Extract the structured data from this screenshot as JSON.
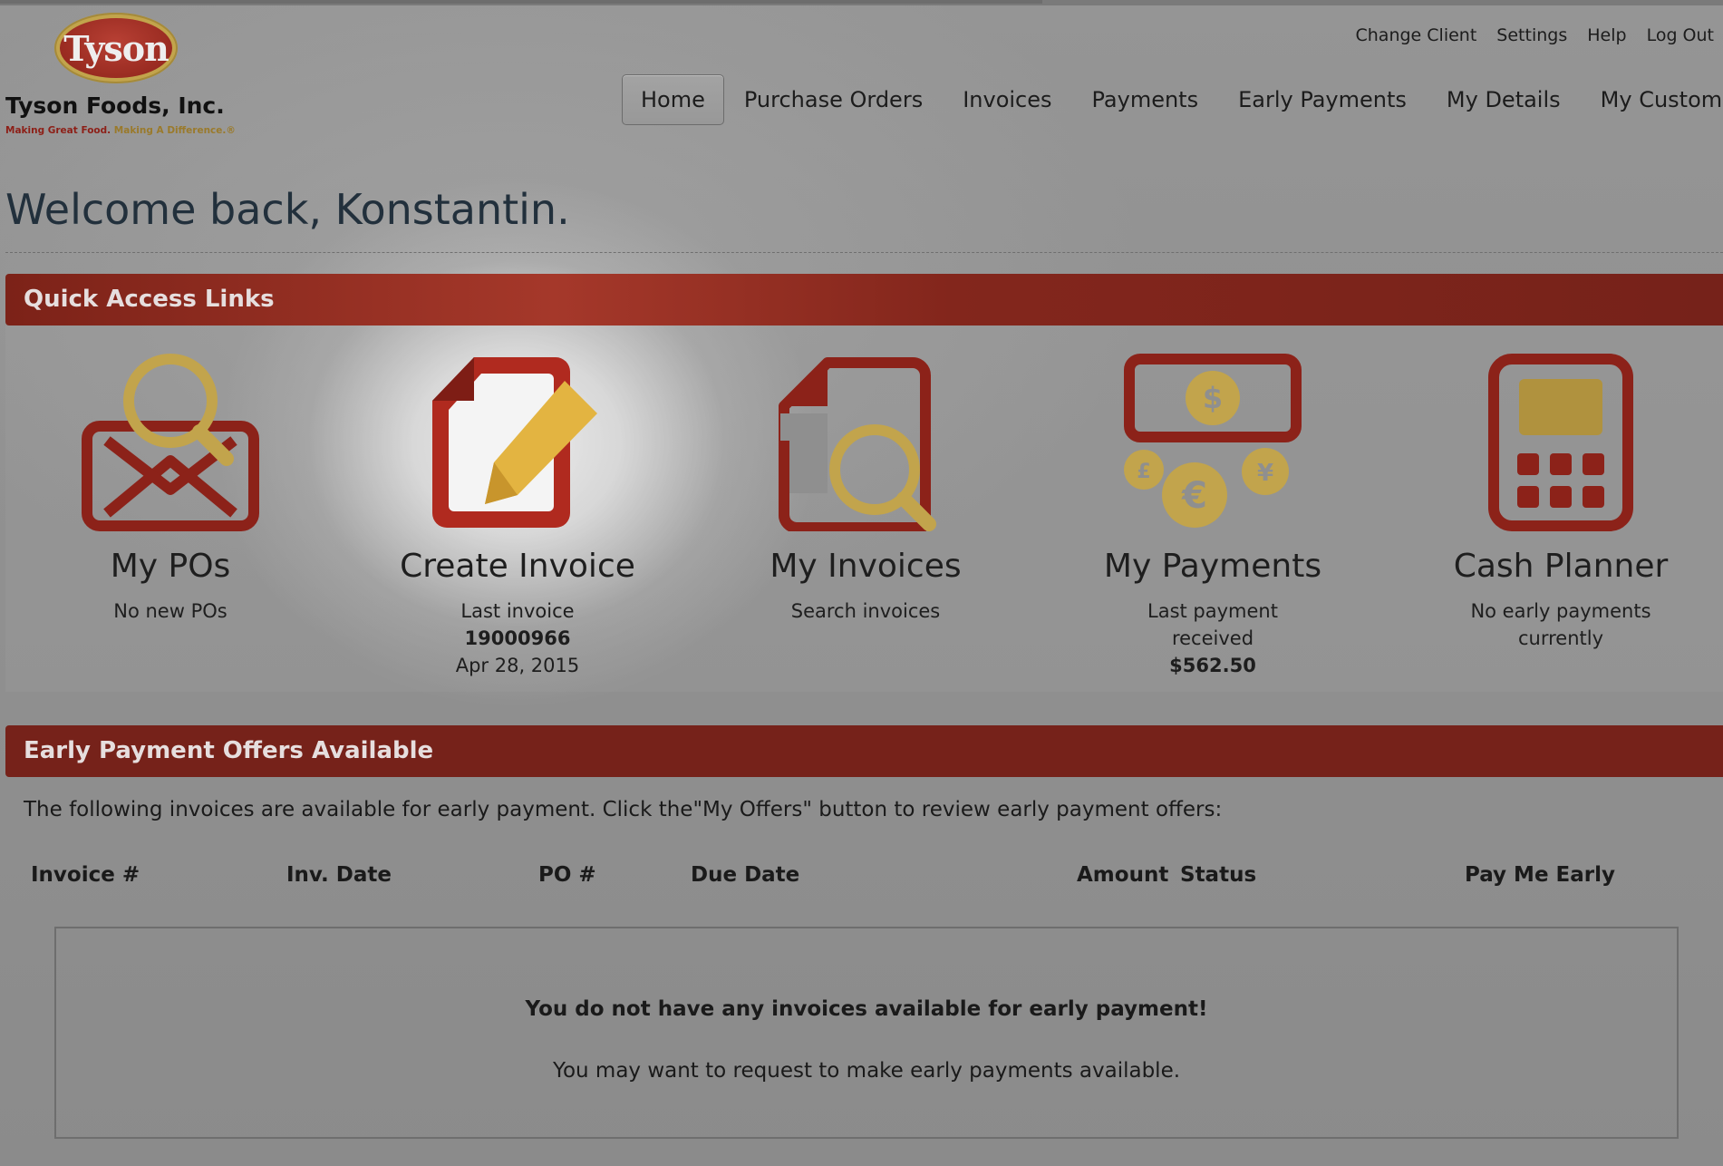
{
  "brand": {
    "logo_word": "Tyson",
    "company": "Tyson Foods, Inc.",
    "tagline_part1": "Making Great Food.",
    "tagline_part2": "Making A Difference.®",
    "colors": {
      "red": "#8c2219",
      "gold": "#c2a44c"
    }
  },
  "util_nav": [
    "Change Client",
    "Settings",
    "Help",
    "Log Out"
  ],
  "main_nav": {
    "active": "Home",
    "items": [
      "Home",
      "Purchase Orders",
      "Invoices",
      "Payments",
      "Early Payments",
      "My Details",
      "My Customer"
    ]
  },
  "welcome": "Welcome back, Konstantin.",
  "quick_access": {
    "heading": "Quick Access Links",
    "items": [
      {
        "title": "My POs",
        "icon": "envelope-search-icon",
        "lines": [
          "No new POs"
        ]
      },
      {
        "title": "Create Invoice",
        "icon": "document-pencil-icon",
        "lines": [
          "Last invoice",
          "19000966",
          "Apr 28, 2015"
        ]
      },
      {
        "title": "My Invoices",
        "icon": "document-search-icon",
        "lines": [
          "Search invoices"
        ]
      },
      {
        "title": "My Payments",
        "icon": "currency-icon",
        "lines": [
          "Last payment",
          "received",
          "$562.50"
        ]
      },
      {
        "title": "Cash Planner",
        "icon": "calculator-icon",
        "lines": [
          "No early payments",
          "currently"
        ]
      }
    ]
  },
  "early_payments": {
    "heading": "Early Payment Offers Available",
    "intro": "The following invoices are available for early payment. Click the\"My Offers\" button to review early payment offers:",
    "columns": [
      "Invoice #",
      "Inv. Date",
      "PO #",
      "Due Date",
      "Amount",
      "Status",
      "Pay Me Early"
    ],
    "empty_title": "You do not have any invoices available for early payment!",
    "empty_message": "You may want to request to make early payments available."
  }
}
